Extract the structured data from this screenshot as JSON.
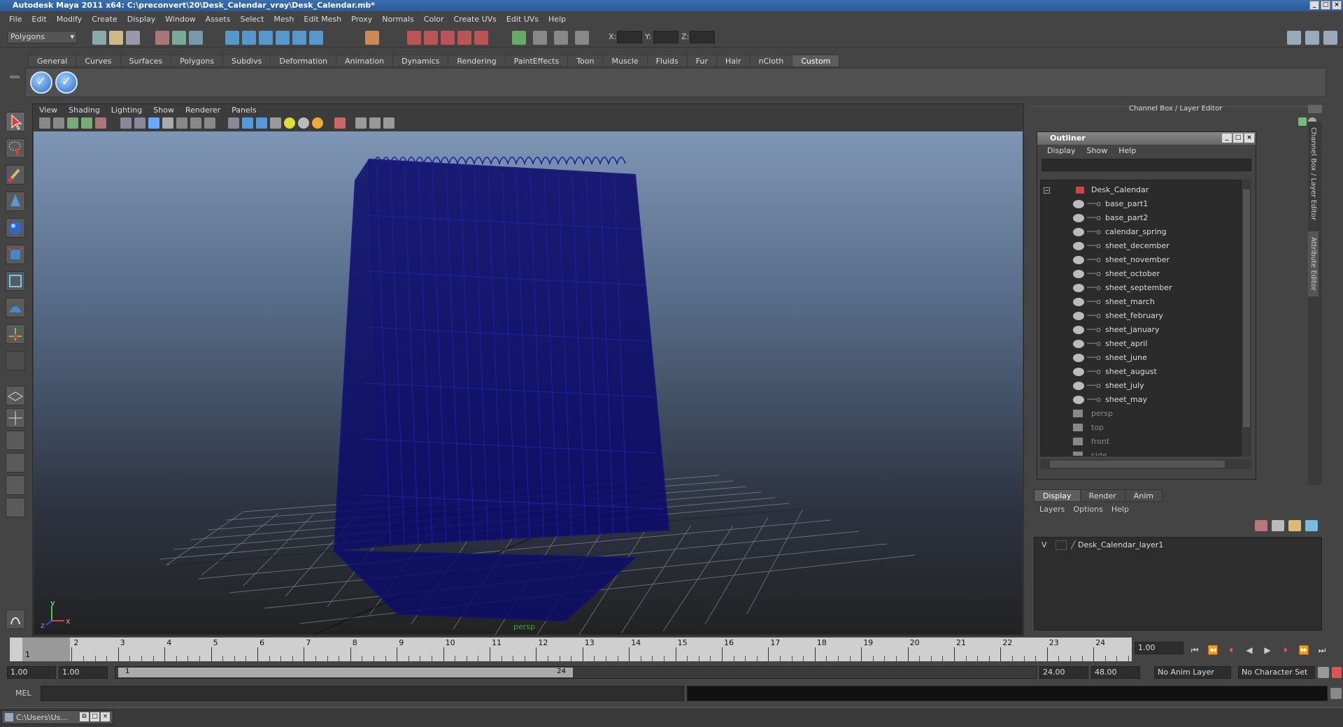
{
  "window": {
    "title": "Autodesk Maya 2011 x64: C:\\preconvert\\20\\Desk_Calendar_vray\\Desk_Calendar.mb*",
    "controls": [
      "_",
      "□",
      "×"
    ]
  },
  "menubar": [
    "File",
    "Edit",
    "Modify",
    "Create",
    "Display",
    "Window",
    "Assets",
    "Select",
    "Mesh",
    "Edit Mesh",
    "Proxy",
    "Normals",
    "Color",
    "Create UVs",
    "Edit UVs",
    "Help"
  ],
  "status_line": {
    "mode": "Polygons",
    "x_label": "X:",
    "y_label": "Y:",
    "z_label": "Z:"
  },
  "shelf": {
    "tabs": [
      "General",
      "Curves",
      "Surfaces",
      "Polygons",
      "Subdivs",
      "Deformation",
      "Animation",
      "Dynamics",
      "Rendering",
      "PaintEffects",
      "Toon",
      "Muscle",
      "Fluids",
      "Fur",
      "Hair",
      "nCloth",
      "Custom"
    ],
    "active_tab": "Custom"
  },
  "viewport": {
    "menu": [
      "View",
      "Shading",
      "Lighting",
      "Show",
      "Renderer",
      "Panels"
    ],
    "camera_label": "persp",
    "axis_y": "y",
    "axis_x": "x",
    "axis_z": "z"
  },
  "channel_box": {
    "title": "Channel Box / Layer Editor",
    "side_tabs": [
      "Channel Box / Layer Editor",
      "Attribute Editor"
    ]
  },
  "outliner": {
    "title": "Outliner",
    "menu": [
      "Display",
      "Show",
      "Help"
    ],
    "root": "Desk_Calendar",
    "children": [
      "base_part1",
      "base_part2",
      "calendar_spring",
      "sheet_december",
      "sheet_november",
      "sheet_october",
      "sheet_september",
      "sheet_march",
      "sheet_february",
      "sheet_january",
      "sheet_april",
      "sheet_june",
      "sheet_august",
      "sheet_july",
      "sheet_may"
    ],
    "cameras": [
      "persp",
      "top",
      "front",
      "side"
    ]
  },
  "layer_editor": {
    "tabs": [
      "Display",
      "Render",
      "Anim"
    ],
    "active_tab": "Display",
    "menu": [
      "Layers",
      "Options",
      "Help"
    ],
    "layers": [
      {
        "visible": "V",
        "name": "Desk_Calendar_layer1"
      }
    ]
  },
  "time_slider": {
    "ticks": [
      "1",
      "2",
      "3",
      "4",
      "5",
      "6",
      "7",
      "8",
      "9",
      "10",
      "11",
      "12",
      "13",
      "14",
      "15",
      "16",
      "17",
      "18",
      "19",
      "20",
      "21",
      "22",
      "23",
      "24"
    ],
    "current_frame": "1.00",
    "current_marker": "1"
  },
  "range_slider": {
    "start": "1.00",
    "anim_start": "1.00",
    "range_start": "1",
    "range_end": "24",
    "anim_end": "24.00",
    "end": "48.00",
    "anim_layer": "No Anim Layer",
    "character_set": "No Character Set"
  },
  "command_line": {
    "label": "MEL"
  },
  "taskbar": {
    "item": "C:\\Users\\Us..."
  }
}
